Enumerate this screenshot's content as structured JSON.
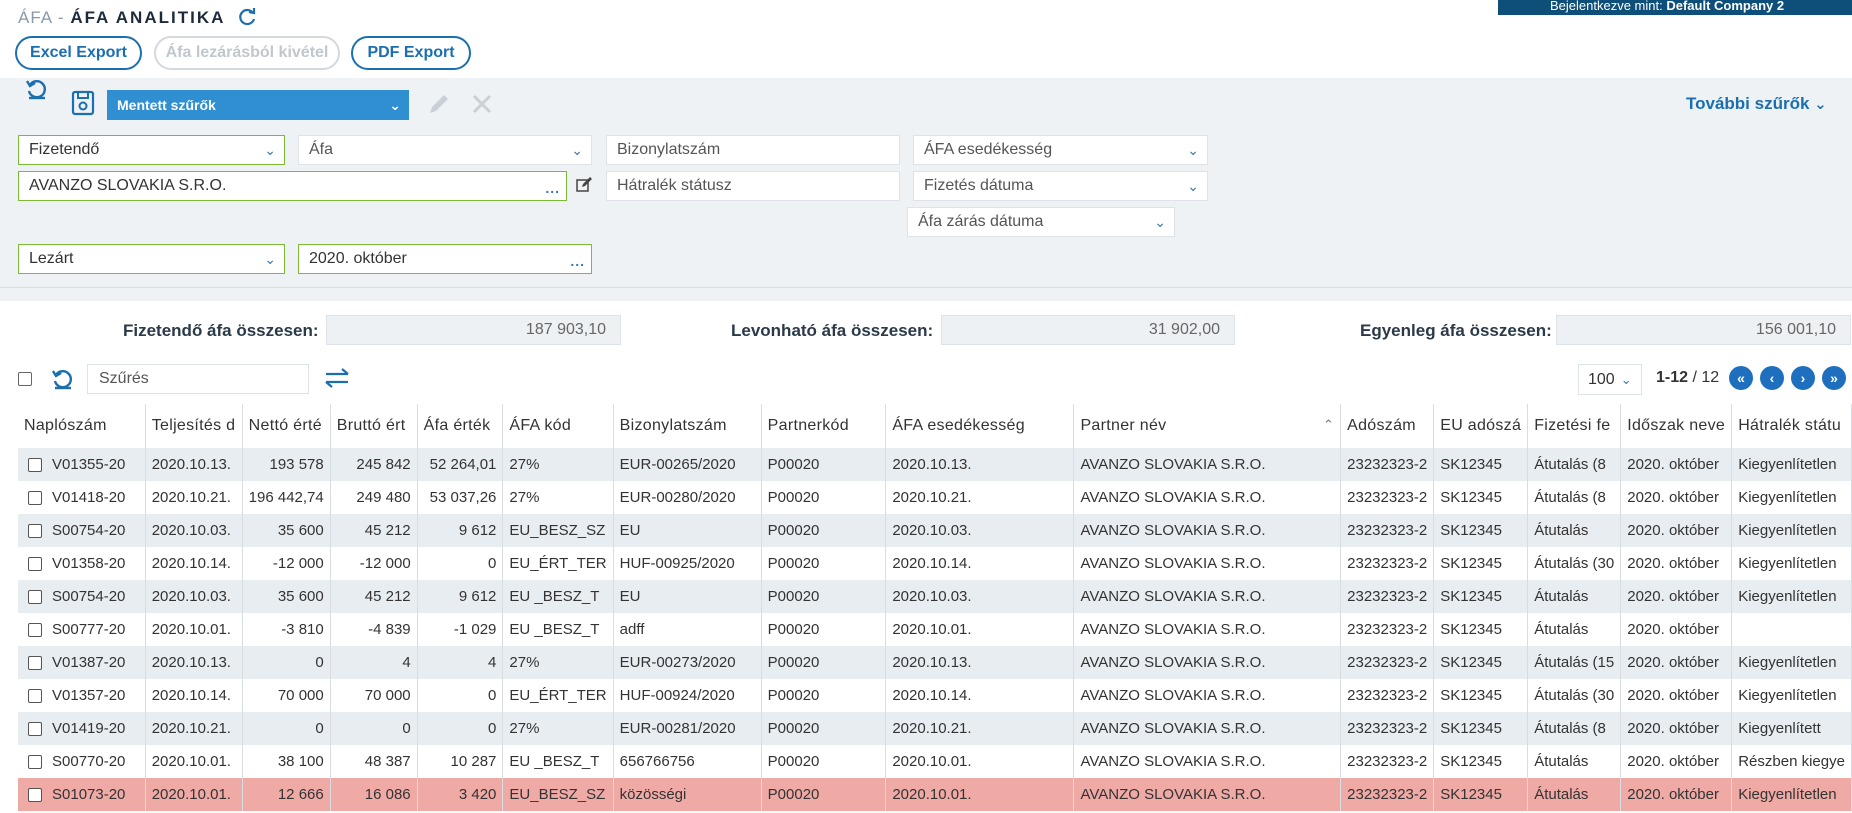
{
  "header": {
    "crumb_parent": "ÁFA -",
    "crumb_current": "ÁFA ANALITIKA",
    "login_prefix": "Bejelentkezve mint:",
    "login_company": "Default Company 2"
  },
  "actions": {
    "excel": "Excel Export",
    "exclude": "Áfa lezárásból kivétel",
    "pdf": "PDF Export"
  },
  "filters": {
    "saved": "Mentett szűrők",
    "more": "További szűrők",
    "fizetendo": "Fizetendő",
    "afa": "Áfa",
    "bizonylatszam": "Bizonylatszám",
    "afa_esedekesseg": "ÁFA esedékesség",
    "partner": "AVANZO SLOVAKIA S.R.O.",
    "hatralek": "Hátralék státusz",
    "fizetes_datuma": "Fizetés dátuma",
    "afa_zaras": "Áfa zárás dátuma",
    "lezart": "Lezárt",
    "period": "2020. október"
  },
  "summary": {
    "fizetendo_label": "Fizetendő áfa összesen:",
    "fizetendo_value": "187 903,10",
    "levonhato_label": "Levonható áfa összesen:",
    "levonhato_value": "31 902,00",
    "egyenleg_label": "Egyenleg áfa összesen:",
    "egyenleg_value": "156 001,10"
  },
  "grid": {
    "filter_placeholder": "Szűrés",
    "page_size": "100",
    "range": "1-12",
    "total": "/ 12",
    "columns": [
      "Naplószám",
      "Teljesítés d",
      "Nettó érté",
      "Bruttó ért",
      "Áfa érték",
      "ÁFA kód",
      "Bizonylatszám",
      "Partnerkód",
      "ÁFA esedékesség",
      "Partner név",
      "Adószám",
      "EU adószá",
      "Fizetési fe",
      "Időszak neve",
      "Hátralék státu"
    ],
    "rows": [
      [
        "V01355-20",
        "2020.10.13.",
        "193 578",
        "245 842",
        "52 264,01",
        "27%",
        "EUR-00265/2020",
        "P00020",
        "2020.10.13.",
        "AVANZO SLOVAKIA S.R.O.",
        "23232323-2",
        "SK12345",
        "Átutalás (8",
        "2020. október",
        "Kiegyenlítetlen"
      ],
      [
        "V01418-20",
        "2020.10.21.",
        "196 442,74",
        "249 480",
        "53 037,26",
        "27%",
        "EUR-00280/2020",
        "P00020",
        "2020.10.21.",
        "AVANZO SLOVAKIA S.R.O.",
        "23232323-2",
        "SK12345",
        "Átutalás (8",
        "2020. október",
        "Kiegyenlítetlen"
      ],
      [
        "S00754-20",
        "2020.10.03.",
        "35 600",
        "45 212",
        "9 612",
        "EU_BESZ_SZ",
        "EU",
        "P00020",
        "2020.10.03.",
        "AVANZO SLOVAKIA S.R.O.",
        "23232323-2",
        "SK12345",
        "Átutalás",
        "2020. október",
        "Kiegyenlítetlen"
      ],
      [
        "V01358-20",
        "2020.10.14.",
        "-12 000",
        "-12 000",
        "0",
        "EU_ÉRT_TER",
        "HUF-00925/2020",
        "P00020",
        "2020.10.14.",
        "AVANZO SLOVAKIA S.R.O.",
        "23232323-2",
        "SK12345",
        "Átutalás (30",
        "2020. október",
        "Kiegyenlítetlen"
      ],
      [
        "S00754-20",
        "2020.10.03.",
        "35 600",
        "45 212",
        "9 612",
        "EU _BESZ_T",
        "EU",
        "P00020",
        "2020.10.03.",
        "AVANZO SLOVAKIA S.R.O.",
        "23232323-2",
        "SK12345",
        "Átutalás",
        "2020. október",
        "Kiegyenlítetlen"
      ],
      [
        "S00777-20",
        "2020.10.01.",
        "-3 810",
        "-4 839",
        "-1 029",
        "EU _BESZ_T",
        "adff",
        "P00020",
        "2020.10.01.",
        "AVANZO SLOVAKIA S.R.O.",
        "23232323-2",
        "SK12345",
        "Átutalás",
        "2020. október",
        ""
      ],
      [
        "V01387-20",
        "2020.10.13.",
        "0",
        "4",
        "4",
        "27%",
        "EUR-00273/2020",
        "P00020",
        "2020.10.13.",
        "AVANZO SLOVAKIA S.R.O.",
        "23232323-2",
        "SK12345",
        "Átutalás (15",
        "2020. október",
        "Kiegyenlítetlen"
      ],
      [
        "V01357-20",
        "2020.10.14.",
        "70 000",
        "70 000",
        "0",
        "EU_ÉRT_TER",
        "HUF-00924/2020",
        "P00020",
        "2020.10.14.",
        "AVANZO SLOVAKIA S.R.O.",
        "23232323-2",
        "SK12345",
        "Átutalás (30",
        "2020. október",
        "Kiegyenlítetlen"
      ],
      [
        "V01419-20",
        "2020.10.21.",
        "0",
        "0",
        "0",
        "27%",
        "EUR-00281/2020",
        "P00020",
        "2020.10.21.",
        "AVANZO SLOVAKIA S.R.O.",
        "23232323-2",
        "SK12345",
        "Átutalás (8",
        "2020. október",
        "Kiegyenlített"
      ],
      [
        "S00770-20",
        "2020.10.01.",
        "38 100",
        "48 387",
        "10 287",
        "EU _BESZ_T",
        "656766756",
        "P00020",
        "2020.10.01.",
        "AVANZO SLOVAKIA S.R.O.",
        "23232323-2",
        "SK12345",
        "Átutalás",
        "2020. október",
        "Részben kiegye"
      ],
      [
        "S01073-20",
        "2020.10.01.",
        "12 666",
        "16 086",
        "3 420",
        "EU_BESZ_SZ",
        "közösségi",
        "P00020",
        "2020.10.01.",
        "AVANZO SLOVAKIA S.R.O.",
        "23232323-2",
        "SK12345",
        "Átutalás",
        "2020. október",
        "Kiegyenlítetlen"
      ]
    ]
  },
  "colors": {
    "accent": "#1b6fb0",
    "highlight_row": "#f0aaa6",
    "stripe": "#e8edf2"
  }
}
